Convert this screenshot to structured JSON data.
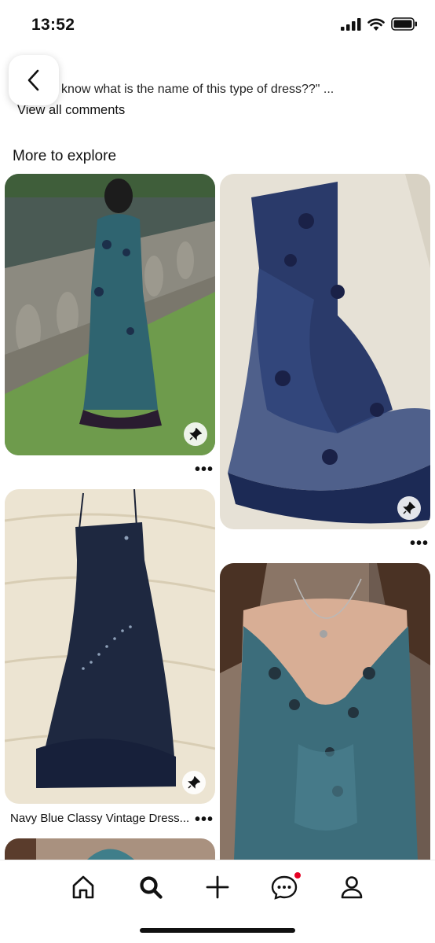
{
  "status_bar": {
    "time": "13:52"
  },
  "comment": {
    "preview_text": "nybody know what is the name of this type of dress??\" ...",
    "view_all_label": "View all comments"
  },
  "explore": {
    "title": "More to explore",
    "pins": [
      {
        "caption": ""
      },
      {
        "caption": ""
      },
      {
        "caption": "Navy Blue Classy Vintage Dress..."
      },
      {
        "caption": ""
      }
    ],
    "more_label": "•••"
  },
  "colors": {
    "accent_notification": "#e60023",
    "text": "#111111"
  },
  "icons": {
    "back": "chevron-left-icon",
    "pin_badge": "pushpin-icon",
    "nav": [
      "home-icon",
      "search-icon",
      "plus-icon",
      "chat-icon",
      "profile-icon"
    ]
  }
}
